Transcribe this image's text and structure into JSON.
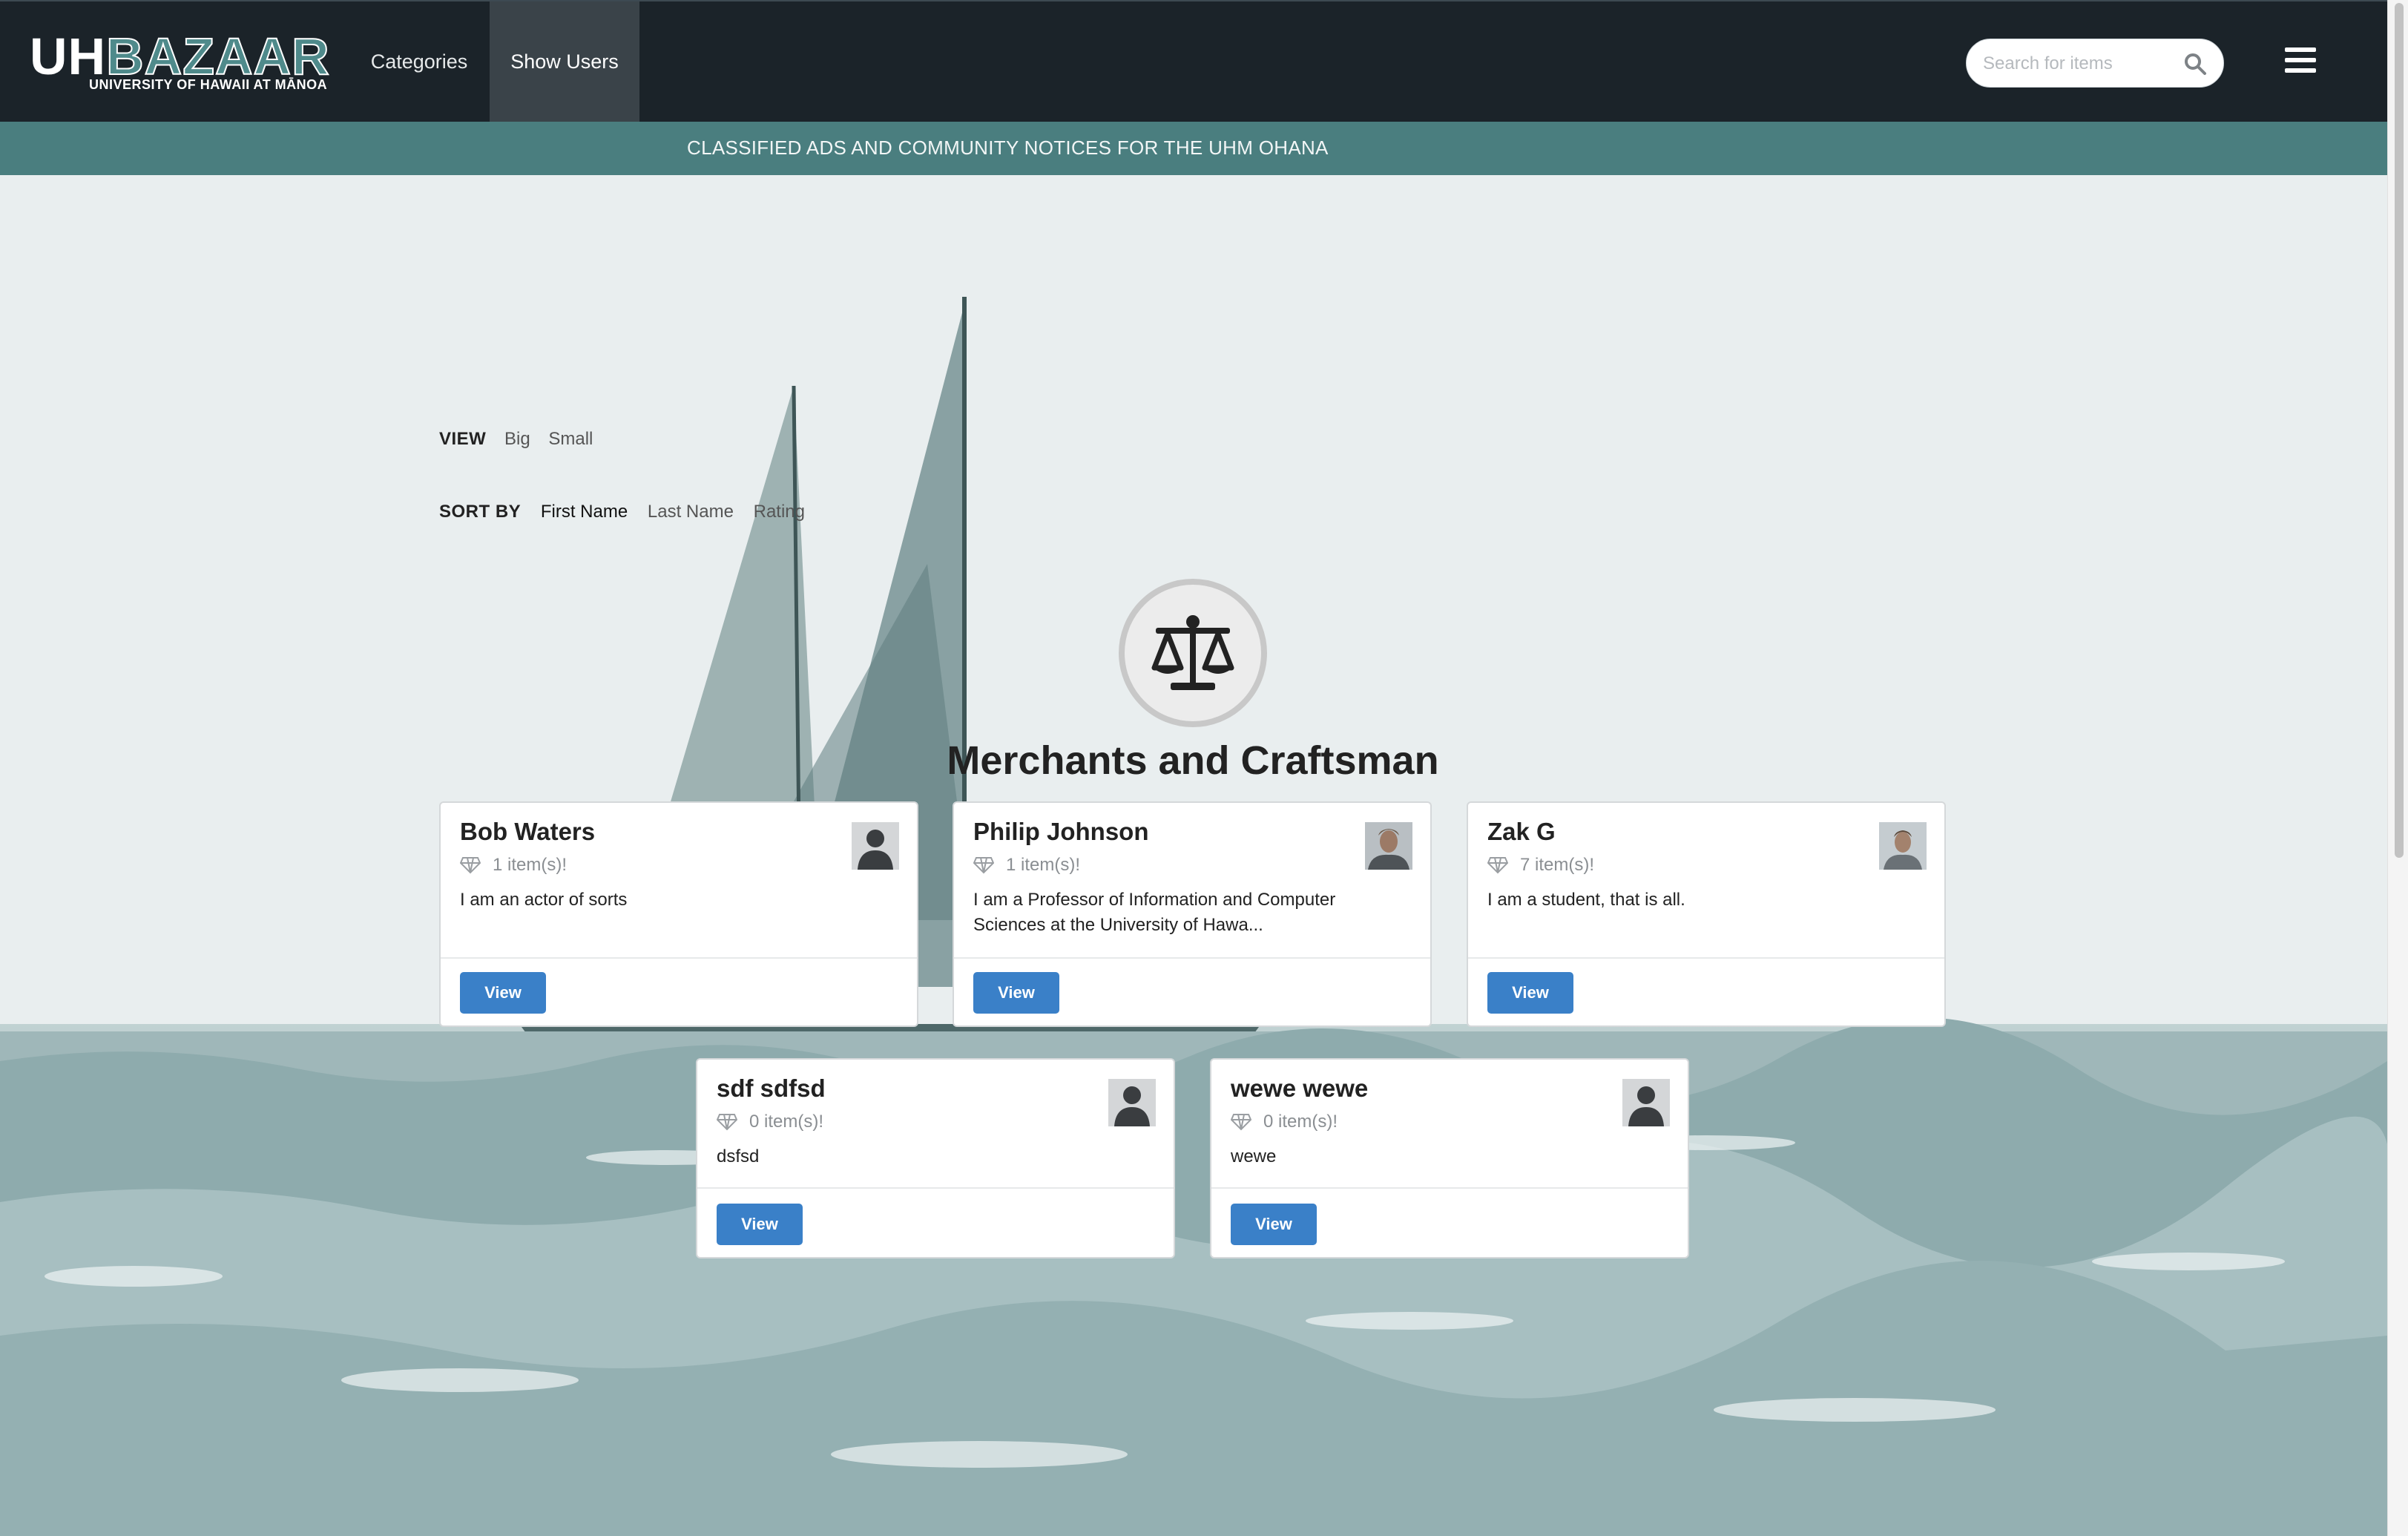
{
  "header": {
    "logo": {
      "uh": "UH",
      "bazaar": "BAZAAR",
      "subtitle": "UNIVERSITY OF HAWAII AT MĀNOA"
    },
    "nav": [
      {
        "label": "Categories"
      },
      {
        "label": "Show Users"
      }
    ],
    "search": {
      "placeholder": "Search for items",
      "value": ""
    }
  },
  "banner": "CLASSIFIED ADS AND COMMUNITY NOTICES FOR THE UHM OHANA",
  "controls": {
    "view_label": "VIEW",
    "view_options": [
      "Big",
      "Small"
    ],
    "sort_label": "SORT BY",
    "sort_options": [
      "First Name",
      "Last Name",
      "Rating"
    ],
    "sort_selected": "First Name"
  },
  "category": {
    "title": "Merchants and Craftsman",
    "icon": "scale-icon"
  },
  "users": [
    {
      "name": "Bob Waters",
      "items": "1 item(s)!",
      "bio": "I am an actor of sorts",
      "button": "View",
      "avatar": "default-avatar"
    },
    {
      "name": "Philip Johnson",
      "items": "1 item(s)!",
      "bio": "I am a Professor of Information and Computer Sciences at the University of Hawa...",
      "button": "View",
      "avatar": "photo-avatar"
    },
    {
      "name": "Zak G",
      "items": "7 item(s)!",
      "bio": "I am a student, that is all.",
      "button": "View",
      "avatar": "photo-avatar"
    },
    {
      "name": "sdf sdfsd",
      "items": "0 item(s)!",
      "bio": "dsfsd",
      "button": "View",
      "avatar": "default-avatar"
    },
    {
      "name": "wewe wewe",
      "items": "0 item(s)!",
      "bio": "wewe",
      "button": "View",
      "avatar": "default-avatar"
    }
  ],
  "colors": {
    "navbar": "#1b2329",
    "banner": "#4a7e7f",
    "button": "#3a80c8",
    "active_nav": "#3a4349"
  }
}
